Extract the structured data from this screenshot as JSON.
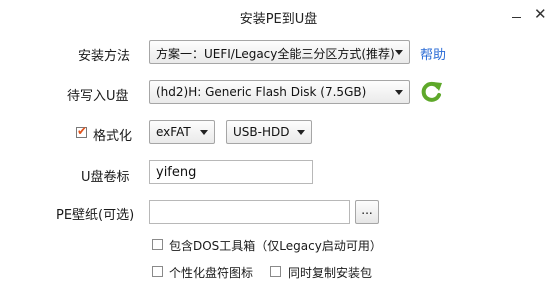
{
  "window": {
    "title": "安装PE到U盘",
    "minimize_icon": "minimize-icon",
    "close_icon": "close-icon"
  },
  "form": {
    "method": {
      "label": "安装方法",
      "value": "方案一：UEFI/Legacy全能三分区方式(推荐)",
      "help_label": "帮助"
    },
    "target_disk": {
      "label": "待写入U盘",
      "value": "(hd2)H: Generic Flash Disk (7.5GB)",
      "refresh_icon": "refresh-icon"
    },
    "format": {
      "label": "格式化",
      "checked": true,
      "filesystem": "exFAT",
      "mode": "USB-HDD"
    },
    "volume_label": {
      "label": "U盘卷标",
      "value": "yifeng"
    },
    "wallpaper": {
      "label": "PE壁纸(可选)",
      "value": "",
      "browse_label": "..."
    },
    "options": {
      "dos_toolbox": {
        "label": "包含DOS工具箱（仅Legacy启动可用）",
        "checked": false
      },
      "custom_icon": {
        "label": "个性化盘符图标",
        "checked": false
      },
      "copy_package": {
        "label": "同时复制安装包",
        "checked": false
      }
    }
  },
  "colors": {
    "accent": "#2a6bd6",
    "check": "#e0521b",
    "refresh": "#5ea82a"
  }
}
